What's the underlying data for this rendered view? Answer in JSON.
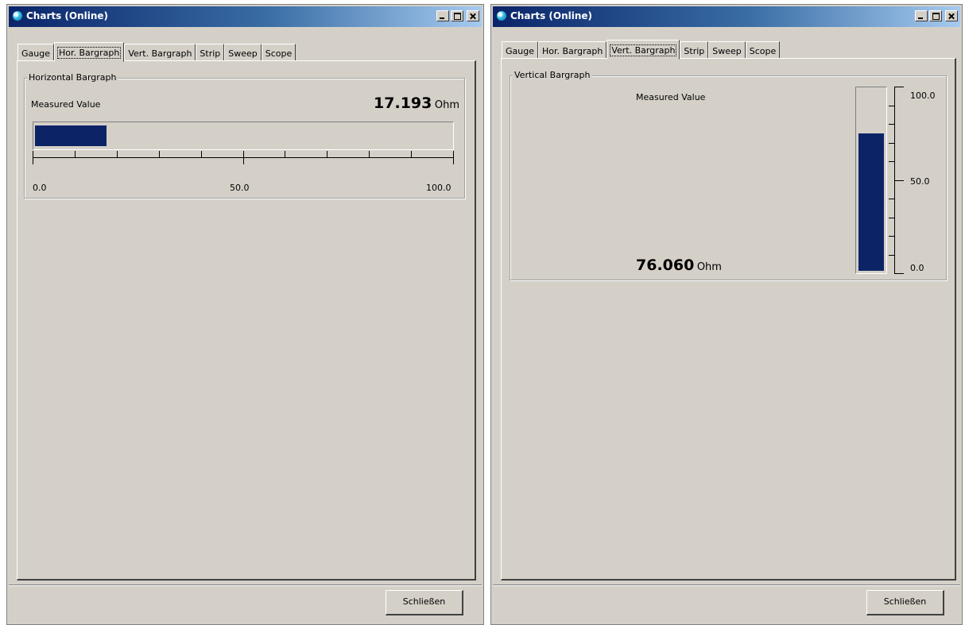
{
  "windows": [
    {
      "title": "Charts (Online)",
      "tabs": [
        "Gauge",
        "Hor. Bargraph",
        "Vert. Bargraph",
        "Strip",
        "Sweep",
        "Scope"
      ],
      "active_tab": "Hor. Bargraph",
      "group_title": "Horizontal Bargraph",
      "measured_label": "Measured Value",
      "value": "17.193",
      "unit": "Ohm",
      "close_label": "Schließen"
    },
    {
      "title": "Charts (Online)",
      "tabs": [
        "Gauge",
        "Hor. Bargraph",
        "Vert. Bargraph",
        "Strip",
        "Sweep",
        "Scope"
      ],
      "active_tab": "Vert. Bargraph",
      "group_title": "Vertical Bargraph",
      "measured_label": "Measured Value",
      "value": "76.060",
      "unit": "Ohm",
      "close_label": "Schließen"
    }
  ],
  "chart_data": [
    {
      "type": "bar",
      "orientation": "horizontal",
      "values": [
        17.193
      ],
      "xlim": [
        0,
        100
      ],
      "tick_labels": [
        "0.0",
        "50.0",
        "100.0"
      ],
      "minor_ticks": 10
    },
    {
      "type": "bar",
      "orientation": "vertical",
      "values": [
        76.06
      ],
      "ylim": [
        0,
        100
      ],
      "tick_labels": [
        "0.0",
        "50.0",
        "100.0"
      ],
      "minor_ticks": 10
    }
  ],
  "colors": {
    "bar": "#0c2466",
    "window_face": "#d4d0c8",
    "titlebar_start": "#0a246a",
    "titlebar_end": "#a6caf0"
  },
  "icons": [
    "app-icon",
    "minimize-icon",
    "maximize-icon",
    "close-icon"
  ]
}
